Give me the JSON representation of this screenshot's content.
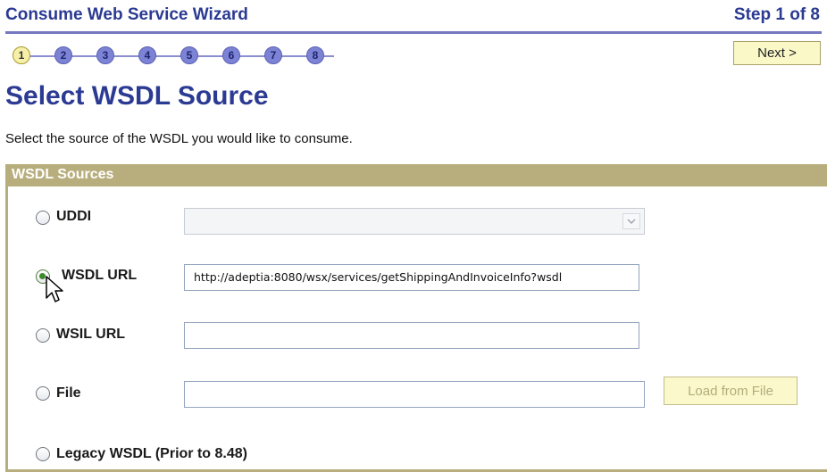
{
  "header": {
    "wizard_title": "Consume Web Service Wizard",
    "step_label": "Step 1 of 8",
    "next_label": "Next >"
  },
  "steps": [
    "1",
    "2",
    "3",
    "4",
    "5",
    "6",
    "7",
    "8"
  ],
  "current_step": 1,
  "page": {
    "heading": "Select WSDL Source",
    "instructions": "Select the source of the WSDL you would like to consume."
  },
  "panel": {
    "title": "WSDL Sources",
    "options": {
      "uddi": {
        "label": "UDDI",
        "selected": false,
        "value": ""
      },
      "wsdl_url": {
        "label": "WSDL URL",
        "selected": true,
        "value": "http://adeptia:8080/wsx/services/getShippingAndInvoiceInfo?wsdl"
      },
      "wsil_url": {
        "label": "WSIL URL",
        "selected": false,
        "value": ""
      },
      "file": {
        "label": "File",
        "selected": false,
        "value": ""
      },
      "legacy": {
        "label": "Legacy WSDL (Prior to 8.48)",
        "selected": false
      }
    },
    "load_button_label": "Load from File"
  },
  "colors": {
    "title_blue": "#2b3a92",
    "panel_header": "#b8ae7d",
    "button_bg": "#fbf8c8"
  }
}
